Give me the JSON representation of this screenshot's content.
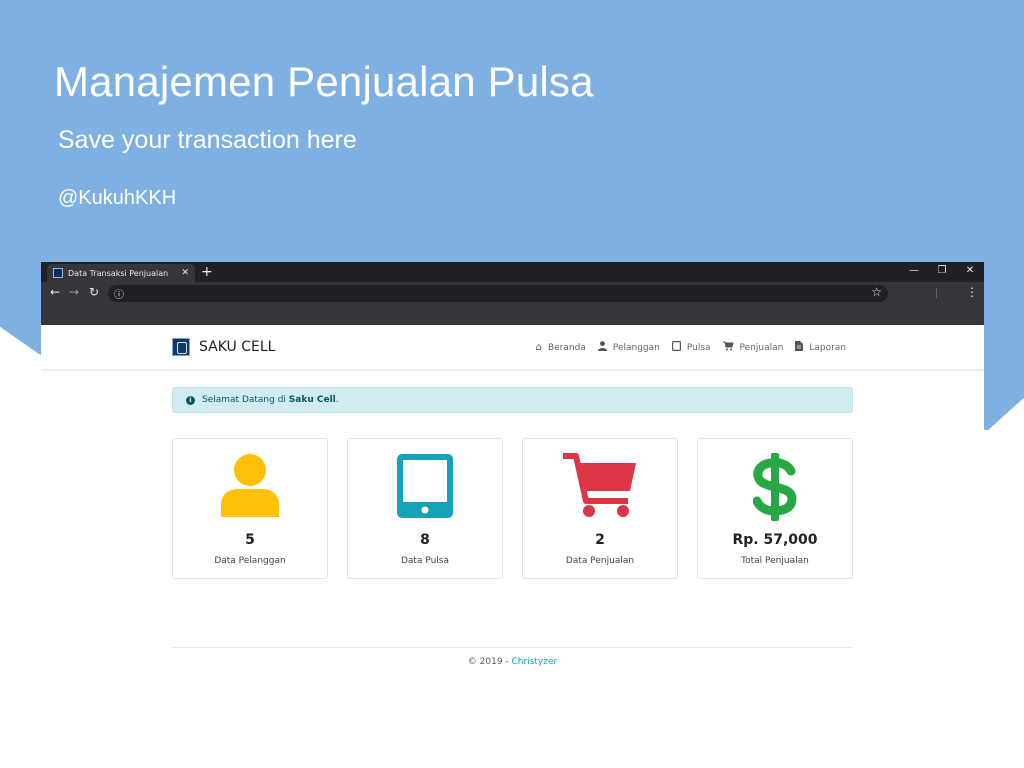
{
  "slide": {
    "title": "Manajemen Penjualan Pulsa",
    "subtitle": "Save your transaction here",
    "handle": "@KukuhKKH"
  },
  "browser": {
    "tab_title": "Data Transaksi Penjualan",
    "new_tab": "+",
    "minimize": "—",
    "restore": "❐",
    "close": "✕"
  },
  "app": {
    "brand": "SAKU CELL",
    "nav": [
      {
        "label": "Beranda",
        "icon": "home-icon"
      },
      {
        "label": "Pelanggan",
        "icon": "user-icon"
      },
      {
        "label": "Pulsa",
        "icon": "tablet-icon"
      },
      {
        "label": "Penjualan",
        "icon": "cart-icon"
      },
      {
        "label": "Laporan",
        "icon": "file-icon"
      }
    ],
    "alert": {
      "prefix": "Selamat Datang di ",
      "strong": "Saku Cell",
      "suffix": "."
    },
    "cards": [
      {
        "value": "5",
        "label": "Data Pelanggan",
        "icon": "user-icon",
        "color": "#ffc107"
      },
      {
        "value": "8",
        "label": "Data Pulsa",
        "icon": "tablet-icon",
        "color": "#17a2b8"
      },
      {
        "value": "2",
        "label": "Data Penjualan",
        "icon": "cart-icon",
        "color": "#dc3545"
      },
      {
        "value": "Rp. 57,000",
        "label": "Total Penjualan",
        "icon": "dollar-icon",
        "color": "#28a745"
      }
    ],
    "footer": {
      "text": "© 2019 - ",
      "link": "Christyzer"
    }
  },
  "colors": {
    "slide_bg": "#7eb1e2",
    "alert_bg": "#d1ecf1",
    "link": "#17a2b8"
  }
}
